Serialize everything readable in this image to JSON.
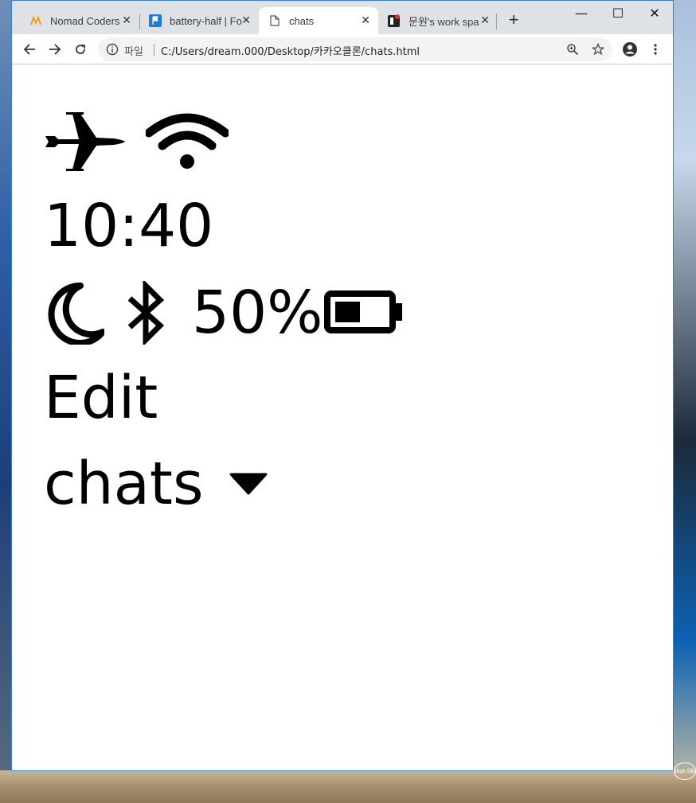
{
  "browser": {
    "tabs": [
      {
        "title": "Nomad Coders",
        "icon": "nomad-logo-icon",
        "active": false
      },
      {
        "title": "battery-half | Fo",
        "icon": "flag-icon",
        "active": false
      },
      {
        "title": "chats",
        "icon": "document-icon",
        "active": true
      },
      {
        "title": "문원's work spa",
        "icon": "notion-icon",
        "active": false
      }
    ],
    "new_tab_label": "+",
    "window_controls": {
      "minimize": "—",
      "maximize": "☐",
      "close": "✕"
    },
    "address_bar": {
      "scheme_label": "파일",
      "url": "C:/Users/dream.000/Desktop/카카오클론/chats.html"
    }
  },
  "page": {
    "status_bar_top": {
      "icons": [
        "airplane-icon",
        "wifi-icon"
      ]
    },
    "time": "10:40",
    "status_bar_bottom": {
      "icons": [
        "moon-icon",
        "bluetooth-icon",
        "battery-half-icon"
      ],
      "battery_percent": "50%",
      "battery_level": 0.5
    },
    "edit_label": "Edit",
    "chats_label": "chats",
    "chats_dropdown_icon": "caret-down-icon"
  },
  "desktop": {
    "watermark_text": "Blue Sky"
  }
}
